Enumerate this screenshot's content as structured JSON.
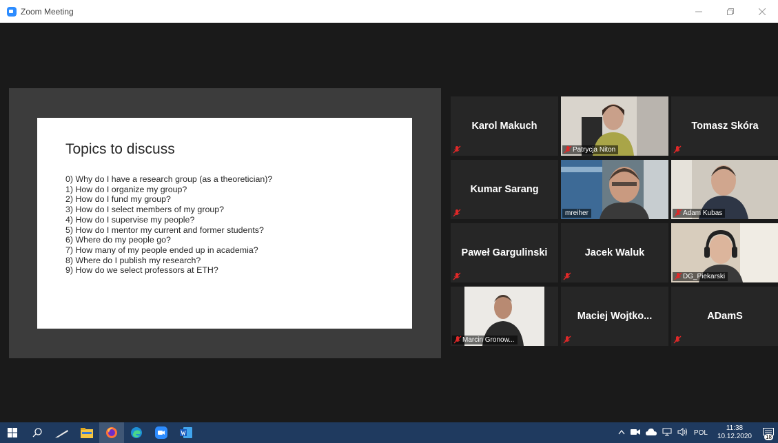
{
  "window": {
    "title": "Zoom Meeting",
    "minimize_icon": "minimize-icon",
    "restore_icon": "restore-icon",
    "close_icon": "close-icon"
  },
  "slide": {
    "title": "Topics to discuss",
    "items": [
      "0) Why do I have a research group (as a theoretician)?",
      "1) How do I organize my group?",
      "2) How do I fund my group?",
      "3) How do I select members of my group?",
      "4) How do I supervise my people?",
      "5) How do I mentor my current and former students?",
      "6) Where do my people go?",
      "7) How many of my people ended up in academia?",
      "8) Where do I publish my research?",
      "9) How do we select professors at ETH?"
    ]
  },
  "participants": [
    {
      "name": "Karol Makuch",
      "video": false
    },
    {
      "name": "Patrycja Niton",
      "video": true
    },
    {
      "name": "Tomasz Skóra",
      "video": false
    },
    {
      "name": "Kumar Sarang",
      "video": false
    },
    {
      "name": "mreiher",
      "video": true,
      "active": true
    },
    {
      "name": "Adam Kubas",
      "video": true
    },
    {
      "name": "Paweł Gargulinski",
      "video": false
    },
    {
      "name": "Jacek Waluk",
      "video": false
    },
    {
      "name": "DG_Piekarski",
      "video": true
    },
    {
      "name": "Marcin Gronow...",
      "video": true
    },
    {
      "name": "Maciej  Wojtko...",
      "video": false
    },
    {
      "name": "ADamS",
      "video": false
    }
  ],
  "taskbar": {
    "icons": [
      "windows-start-icon",
      "search-icon",
      "pen-icon",
      "file-explorer-icon",
      "firefox-icon",
      "edge-icon",
      "zoom-icon",
      "word-icon"
    ],
    "tray": {
      "language": "POL",
      "time": "11:38",
      "date": "10.12.2020",
      "notifications": "18"
    }
  }
}
